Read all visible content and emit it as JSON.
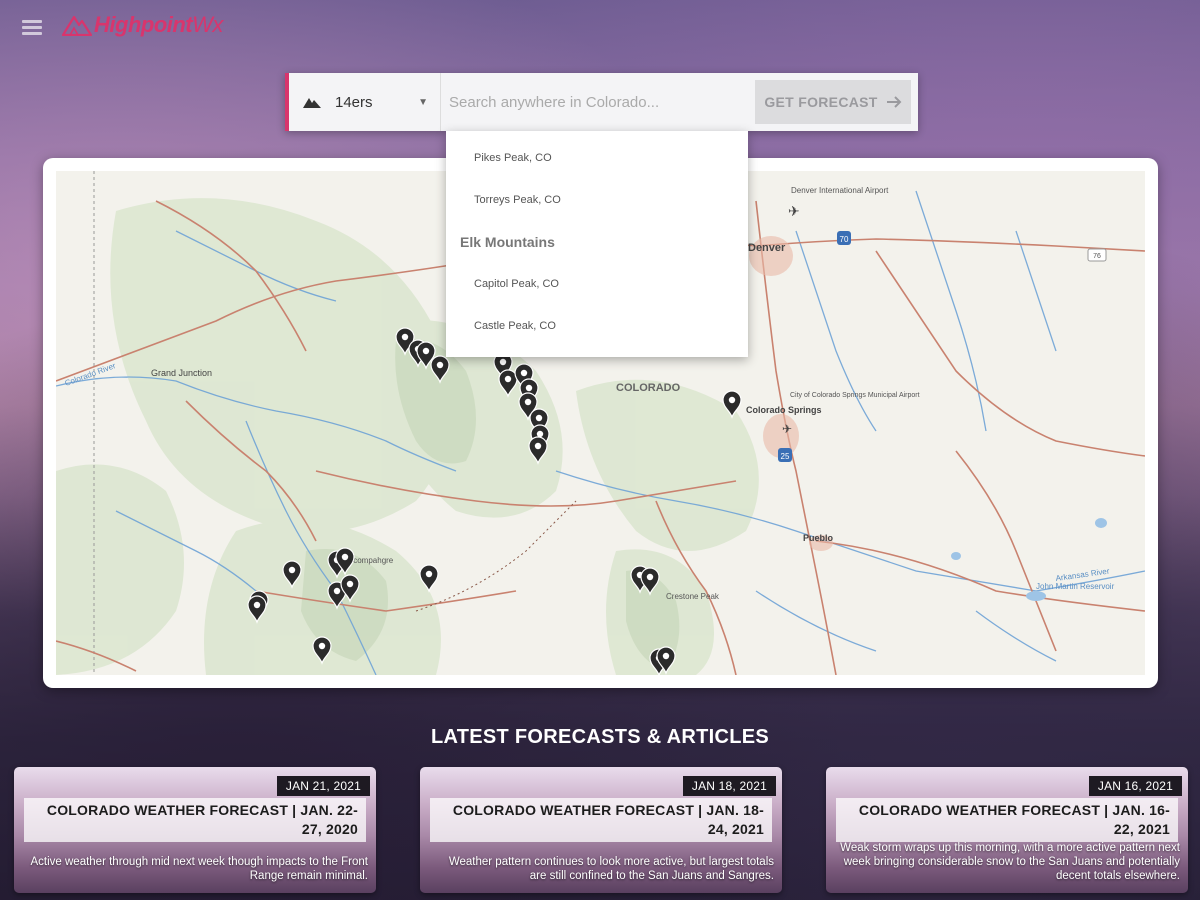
{
  "header": {
    "logo_main": "Highpoint",
    "logo_suffix": "Wx"
  },
  "search": {
    "category_value": "14ers",
    "placeholder": "Search anywhere in Colorado...",
    "button_label": "GET FORECAST",
    "button_icon": "arrow-right-icon"
  },
  "dropdown": {
    "items_top": [
      "Pikes Peak, CO",
      "Torreys Peak, CO"
    ],
    "group_label": "Elk Mountains",
    "items_bottom": [
      "Capitol Peak, CO",
      "Castle Peak, CO"
    ]
  },
  "map": {
    "labels": {
      "state": "COLORADO",
      "denver": "Denver",
      "airport": "Denver International Airport",
      "co_springs": "Colorado Springs",
      "co_springs_airport": "City of Colorado Springs Municipal Airport",
      "pueblo": "Pueblo",
      "grand_junction": "Grand Junction",
      "colorado_river": "Colorado River",
      "john_martin": "John Martin Reservoir",
      "arkansas_river": "Arkansas River",
      "uncompahgre": "Uncompahgre",
      "crestone": "Crestone Peak",
      "i70": "70",
      "i25": "25",
      "r76": "76"
    }
  },
  "articles": {
    "section_title": "LATEST FORECASTS & ARTICLES",
    "cards": [
      {
        "date": "JAN 21, 2021",
        "title": "COLORADO WEATHER FORECAST | JAN. 22-27, 2020",
        "desc": "Active weather through mid next week though impacts to the Front Range remain minimal."
      },
      {
        "date": "JAN 18, 2021",
        "title": "COLORADO WEATHER FORECAST | JAN. 18-24, 2021",
        "desc": "Weather pattern continues to look more active, but largest totals are still confined to the San Juans and Sangres."
      },
      {
        "date": "JAN 16, 2021",
        "title": "COLORADO WEATHER FORECAST | JAN. 16-22, 2021",
        "desc": "Weak storm wraps up this morning, with a more active pattern next week bringing considerable snow to the San Juans and potentially decent totals elsewhere."
      }
    ]
  },
  "colors": {
    "brand": "#d8356d",
    "marker": "#2b2b2b",
    "road": "#c9826f",
    "river": "#6fa3d6"
  }
}
